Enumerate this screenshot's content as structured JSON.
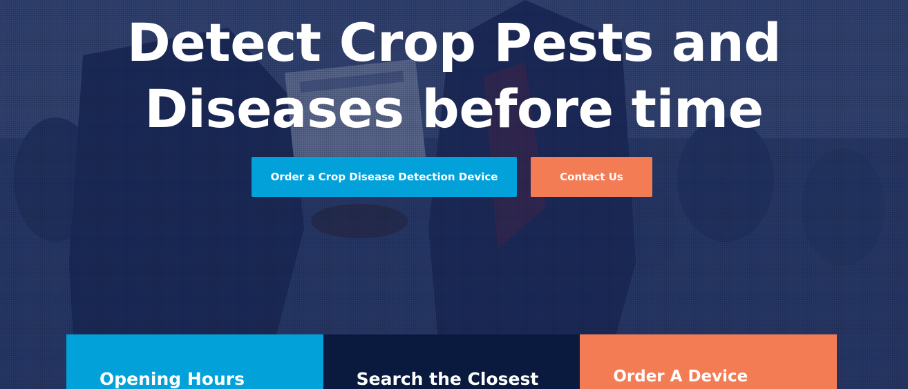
{
  "hero": {
    "headline_line1": "Detect Crop Pests and",
    "headline_line2": "Diseases before time",
    "primary_button_label": "Order a Crop Disease Detection Device",
    "secondary_button_label": "Contact Us"
  },
  "cards": [
    {
      "title": "Opening Hours"
    },
    {
      "title": "Search the Closest"
    },
    {
      "title": "Order A Device"
    }
  ],
  "colors": {
    "overlay": "#1c2c5c",
    "primary": "#03a1da",
    "accent": "#f47c55",
    "dark": "#091a3e",
    "text": "#ffffff"
  }
}
